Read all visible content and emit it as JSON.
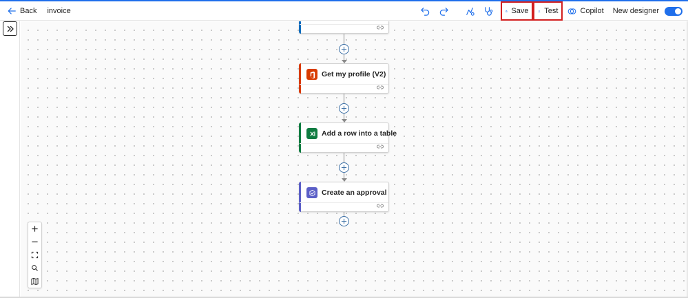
{
  "header": {
    "back_label": "Back",
    "flow_name": "invoice",
    "save_label": "Save",
    "test_label": "Test",
    "copilot_label": "Copilot",
    "new_designer_label": "New designer",
    "new_designer_on": true
  },
  "flow": {
    "steps": [
      {
        "title": "",
        "color": "#0f6cbd"
      },
      {
        "title": "Get my profile (V2)",
        "color": "#d83b01",
        "icon": "office-icon"
      },
      {
        "title": "Add a row into a table",
        "color": "#107c41",
        "icon": "excel-icon"
      },
      {
        "title": "Create an approval",
        "color": "#5b5fc7",
        "icon": "approvals-icon"
      }
    ]
  },
  "zoom_controls": [
    "zoom-in",
    "zoom-out",
    "fit-view",
    "search",
    "minimap"
  ],
  "colors": {
    "accent": "#1f6feb",
    "highlight_outline": "#d21f1f"
  }
}
